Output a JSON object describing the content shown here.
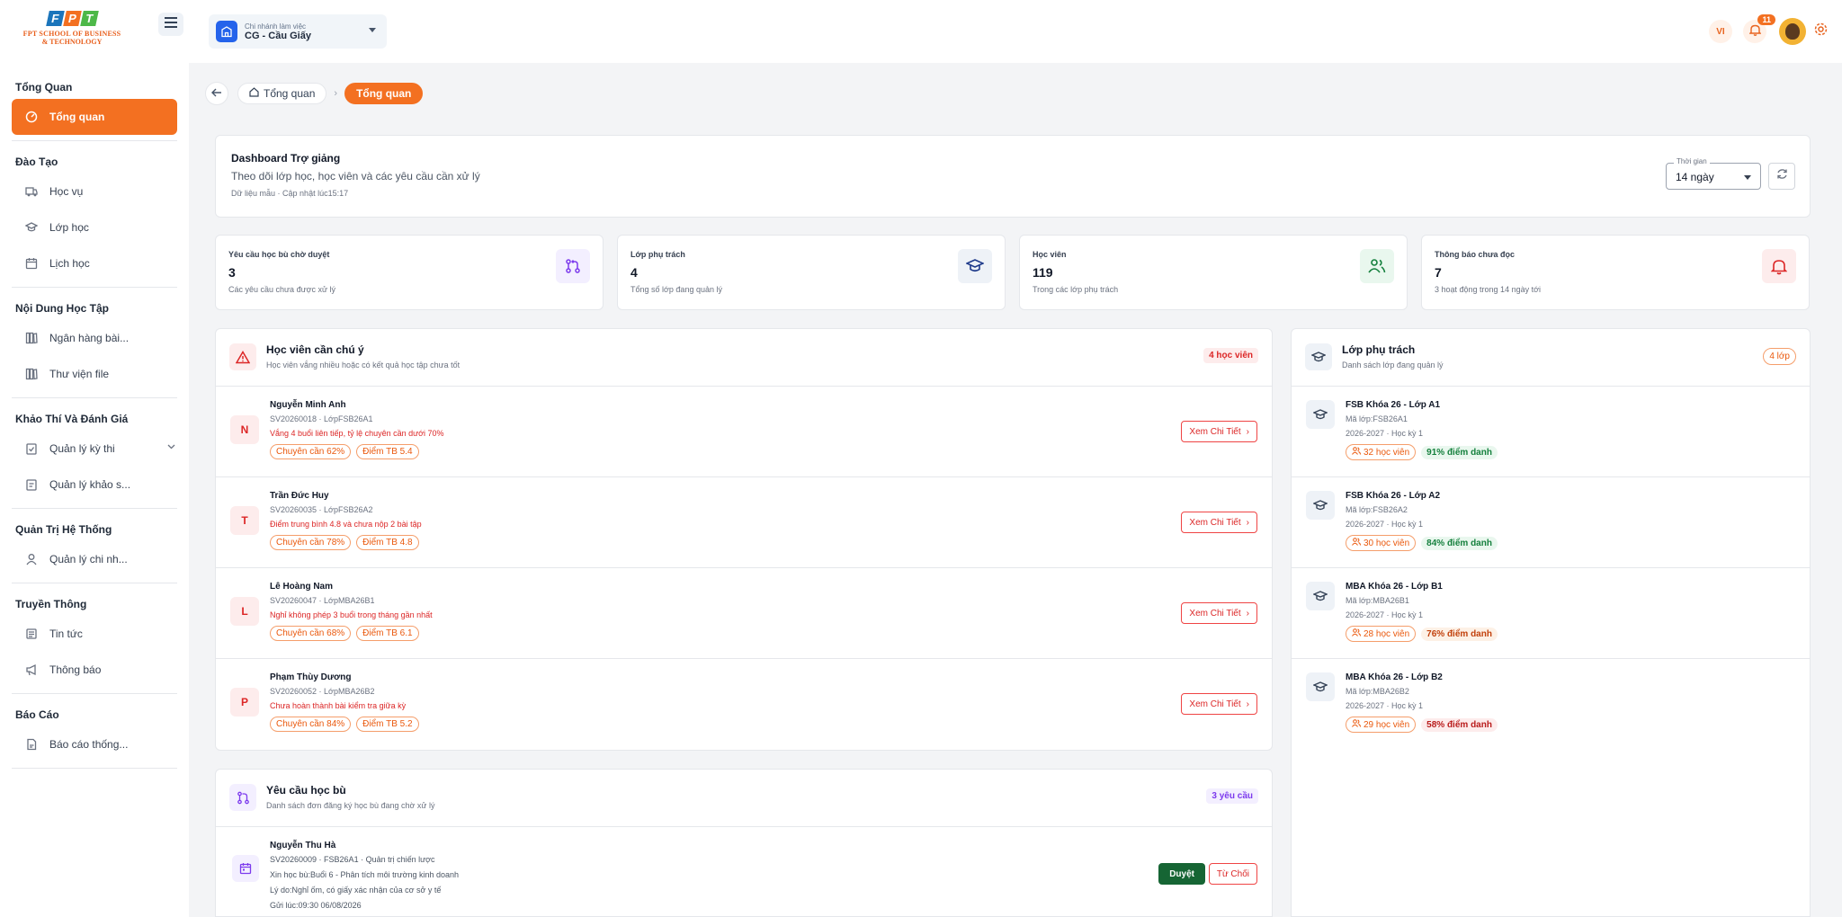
{
  "logo": {
    "letters": [
      "F",
      "P",
      "T"
    ],
    "line1": "FPT SCHOOL OF BUSINESS",
    "line2": "& TECHNOLOGY"
  },
  "sidebar": {
    "sections": [
      {
        "title": "Tổng Quan",
        "items": [
          {
            "label": "Tổng quan",
            "icon": "dashboard-icon",
            "active": true
          }
        ]
      },
      {
        "title": "Đào Tạo",
        "items": [
          {
            "label": "Học vụ",
            "icon": "truck-icon"
          },
          {
            "label": "Lớp học",
            "icon": "graduation-cap-icon"
          },
          {
            "label": "Lịch học",
            "icon": "calendar-icon"
          }
        ]
      },
      {
        "title": "Nội Dung Học Tập",
        "items": [
          {
            "label": "Ngân hàng bài...",
            "icon": "library-icon"
          },
          {
            "label": "Thư viện file",
            "icon": "library-icon"
          }
        ]
      },
      {
        "title": "Khảo Thí Và Đánh Giá",
        "items": [
          {
            "label": "Quản lý kỳ thi",
            "icon": "clipboard-check-icon",
            "expandable": true
          },
          {
            "label": "Quản lý khảo s...",
            "icon": "clipboard-icon"
          }
        ]
      },
      {
        "title": "Quản Trị Hệ Thống",
        "items": [
          {
            "label": "Quản lý chi nh...",
            "icon": "user-icon"
          }
        ]
      },
      {
        "title": "Truyền Thông",
        "items": [
          {
            "label": "Tin tức",
            "icon": "newspaper-icon"
          },
          {
            "label": "Thông báo",
            "icon": "megaphone-icon"
          }
        ]
      },
      {
        "title": "Báo Cáo",
        "items": [
          {
            "label": "Báo cáo thống...",
            "icon": "report-icon"
          }
        ]
      }
    ]
  },
  "topbar": {
    "branch_label": "Chi nhánh làm việc",
    "branch_value": "CG - Cầu Giấy",
    "lang": "VI",
    "notif_count": "11"
  },
  "breadcrumb": {
    "home": "Tổng quan",
    "current": "Tổng quan"
  },
  "header": {
    "title": "Dashboard Trợ giảng",
    "subtitle": "Theo dõi lớp học, học viên và các yêu cầu cần xử lý",
    "meta": "Dữ liệu mẫu · Cập nhật lúc15:17",
    "time_label": "Thời gian",
    "time_value": "14 ngày"
  },
  "stats": [
    {
      "label": "Yêu cầu học bù chờ duyệt",
      "value": "3",
      "sub": "Các yêu cầu chưa được xử lý",
      "icon": "git-pull-icon",
      "color": "#7c3aed",
      "bg": "#f3efff"
    },
    {
      "label": "Lớp phụ trách",
      "value": "4",
      "sub": "Tổng số lớp đang quản lý",
      "icon": "graduation-cap-icon",
      "color": "#1e3a8a",
      "bg": "#eef2f7"
    },
    {
      "label": "Học viên",
      "value": "119",
      "sub": "Trong các lớp phụ trách",
      "icon": "users-icon",
      "color": "#15803d",
      "bg": "#e9f7ee"
    },
    {
      "label": "Thông báo chưa đọc",
      "value": "7",
      "sub": "3 hoạt động trong 14 ngày tới",
      "icon": "bell-icon",
      "color": "#dc2626",
      "bg": "#fdecec"
    }
  ],
  "students": {
    "title": "Học viên cần chú ý",
    "subtitle": "Học viên vắng nhiều hoặc có kết quả học tập chưa tốt",
    "badge": "4 học viên",
    "view_label": "Xem Chi Tiết",
    "items": [
      {
        "initial": "N",
        "name": "Nguyễn Minh Anh",
        "id": "SV20260018 · LớpFSB26A1",
        "issue": "Vắng 4 buổi liên tiếp, tỷ lệ chuyên cần dưới 70%",
        "tags": [
          "Chuyên cần 62%",
          "Điểm TB 5.4"
        ]
      },
      {
        "initial": "T",
        "name": "Trần Đức Huy",
        "id": "SV20260035 · LớpFSB26A2",
        "issue": "Điểm trung bình 4.8 và chưa nộp 2 bài tập",
        "tags": [
          "Chuyên cần 78%",
          "Điểm TB 4.8"
        ]
      },
      {
        "initial": "L",
        "name": "Lê Hoàng Nam",
        "id": "SV20260047 · LớpMBA26B1",
        "issue": "Nghỉ không phép 3 buổi trong tháng gần nhất",
        "tags": [
          "Chuyên cần 68%",
          "Điểm TB 6.1"
        ]
      },
      {
        "initial": "P",
        "name": "Phạm Thùy Dương",
        "id": "SV20260052 · LớpMBA26B2",
        "issue": "Chưa hoàn thành bài kiểm tra giữa kỳ",
        "tags": [
          "Chuyên cần 84%",
          "Điểm TB 5.2"
        ]
      }
    ]
  },
  "classes": {
    "title": "Lớp phụ trách",
    "subtitle": "Danh sách lớp đang quản lý",
    "badge": "4 lớp",
    "items": [
      {
        "name": "FSB Khóa 26 - Lớp A1",
        "code": "Mã lớp:FSB26A1",
        "term": "2026-2027 · Học kỳ 1",
        "students": "32 học viên",
        "attendance": "91% điểm danh",
        "level": "good"
      },
      {
        "name": "FSB Khóa 26 - Lớp A2",
        "code": "Mã lớp:FSB26A2",
        "term": "2026-2027 · Học kỳ 1",
        "students": "30 học viên",
        "attendance": "84% điểm danh",
        "level": "good"
      },
      {
        "name": "MBA Khóa 26 - Lớp B1",
        "code": "Mã lớp:MBA26B1",
        "term": "2026-2027 · Học kỳ 1",
        "students": "28 học viên",
        "attendance": "76% điểm danh",
        "level": "warn"
      },
      {
        "name": "MBA Khóa 26 - Lớp B2",
        "code": "Mã lớp:MBA26B2",
        "term": "2026-2027 · Học kỳ 1",
        "students": "29 học viên",
        "attendance": "58% điểm danh",
        "level": "bad"
      }
    ]
  },
  "requests": {
    "title": "Yêu cầu học bù",
    "subtitle": "Danh sách đơn đăng ký học bù đang chờ xử lý",
    "badge": "3 yêu cầu",
    "approve_label": "Duyệt",
    "reject_label": "Từ Chối",
    "items": [
      {
        "name": "Nguyễn Thu Hà",
        "id": "SV20260009 · FSB26A1 · Quản trị chiến lược",
        "detail": "Xin học bù:Buổi 6 - Phân tích môi trường kinh doanh",
        "reason": "Lý do:Nghỉ ốm, có giấy xác nhận của cơ sở y tế",
        "sent": "Gửi lúc:09:30 06/08/2026"
      }
    ]
  }
}
